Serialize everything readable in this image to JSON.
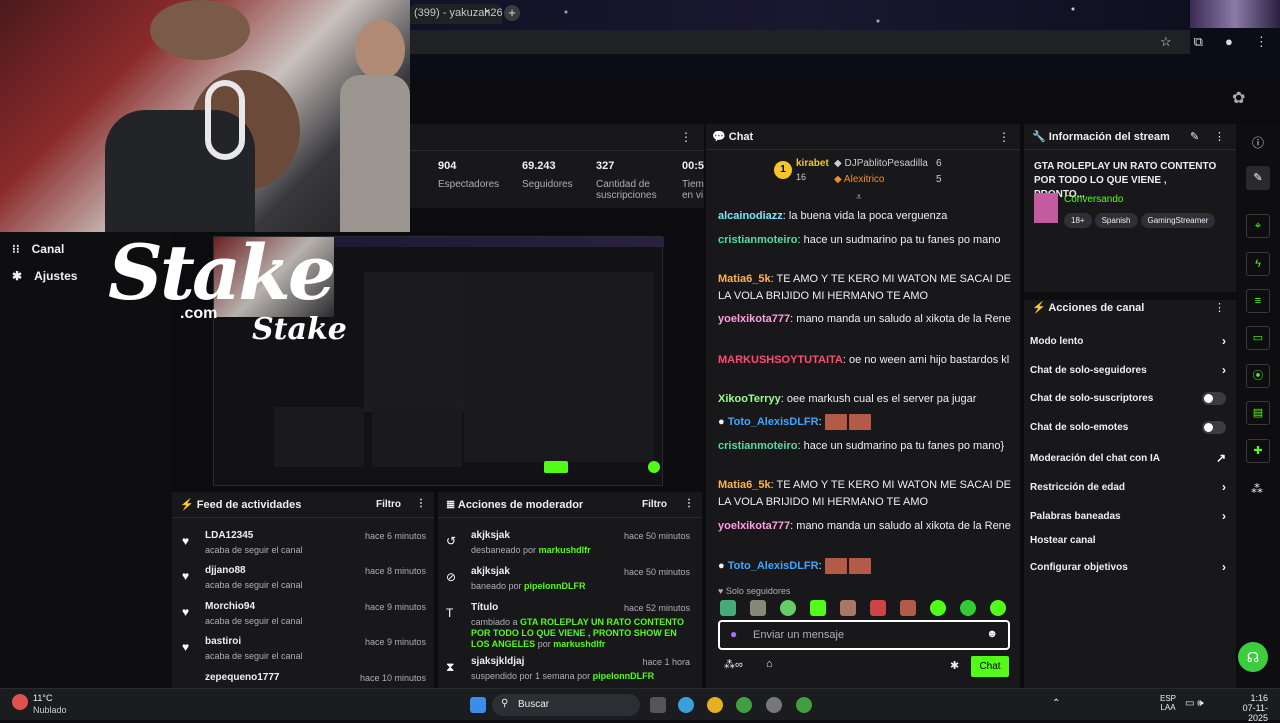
{
  "browser": {
    "tab_title": "(399) - yakuzah26",
    "tab_close": "×",
    "new_tab": "+"
  },
  "left_nav": {
    "items": [
      {
        "label": "Canal",
        "icon": "grid-icon"
      },
      {
        "label": "Ajustes",
        "icon": "gear-icon"
      }
    ]
  },
  "overlay": {
    "brand": "Stake",
    "brand_sub": ".com"
  },
  "stats": [
    {
      "value": "904",
      "label": "Espectadores"
    },
    {
      "value": "69.243",
      "label": "Seguidores"
    },
    {
      "value": "327",
      "label": "Cantidad de suscripciones"
    },
    {
      "value": "00:5",
      "label": "Tiem en vi"
    }
  ],
  "feed": {
    "title": "Feed de actividades",
    "filter": "Filtro",
    "items": [
      {
        "name": "LDA12345",
        "sub": "acaba de seguir el canal",
        "time": "hace 6 minutos"
      },
      {
        "name": "djjano88",
        "sub": "acaba de seguir el canal",
        "time": "hace 8 minutos"
      },
      {
        "name": "Morchio94",
        "sub": "acaba de seguir el canal",
        "time": "hace 9 minutos"
      },
      {
        "name": "bastiroi",
        "sub": "acaba de seguir el canal",
        "time": "hace 9 minutos"
      },
      {
        "name": "zepequeno1777",
        "sub": "",
        "time": "hace 10 minutos"
      }
    ]
  },
  "mod": {
    "title": "Acciones de moderador",
    "filter": "Filtro",
    "items": [
      {
        "name": "akjksjak",
        "pre": "desbaneado por ",
        "by": "markushdlfr",
        "post": "",
        "time": "hace 50 minutos",
        "icon": "unban-icon"
      },
      {
        "name": "akjksjak",
        "pre": "baneado por ",
        "by": "pipelonnDLFR",
        "post": "",
        "time": "hace 50 minutos",
        "icon": "ban-icon"
      },
      {
        "name": "Título",
        "pre": "cambiado a ",
        "by": "GTA ROLEPLAY UN RATO CONTENTO POR TODO LO QUE VIENE , PRONTO SHOW EN LOS ANGELES",
        "post": " por ",
        "by2": "markushdlfr",
        "time": "hace 52 minutos",
        "icon": "title-icon"
      },
      {
        "name": "sjaksjkldjaj",
        "pre": "suspendido por 1 semana por ",
        "by": "pipelonnDLFR",
        "post": "",
        "time": "hace 1 hora",
        "icon": "timeout-icon"
      }
    ]
  },
  "chat": {
    "title": "Chat",
    "leaderboard": {
      "rank1": {
        "name": "kirabet",
        "count": "16"
      },
      "rank2": {
        "name": "DJPablitoPesadilla",
        "count": "6"
      },
      "rank3": {
        "name": "Alexitrico",
        "count": "5"
      }
    },
    "messages": [
      {
        "user": "alcainodiazz",
        "color": "#7ee3ff",
        "text": "la buena vida la poca verguenza"
      },
      {
        "user": "cristianmoteiro",
        "color": "#57d9a3",
        "text": "hace un sudmarino pa tu fanes po mano"
      },
      {
        "user": "Matia6_5k",
        "color": "#ffb347",
        "text": "TE AMO Y TE KERO MI WATON ME SACAI DE LA VOLA BRIJIDO MI HERMANO TE AMO"
      },
      {
        "user": "yoelxikota777",
        "color": "#ff9ee0",
        "text": "mano manda un saludo al xikota de la Rene"
      },
      {
        "user": "MARKUSHSOYTUTAITA",
        "color": "#ff4d6d",
        "text": "oe no ween ami hijo bastardos kl"
      },
      {
        "user": "XikooTerryy",
        "color": "#9aff8c",
        "text": "oee markush cual es el server pa jugar"
      },
      {
        "user": "Toto_AlexisDLFR",
        "color": "#3ea6ff",
        "text": ""
      },
      {
        "user": "cristianmoteiro",
        "color": "#57d9a3",
        "text": "hace un sudmarino pa tu fanes po mano}"
      },
      {
        "user": "Matia6_5k",
        "color": "#ffb347",
        "text": "TE AMO Y TE KERO MI WATON ME SACAI DE LA VOLA BRIJIDO MI HERMANO TE AMO"
      },
      {
        "user": "yoelxikota777",
        "color": "#ff9ee0",
        "text": "mano manda un saludo al xikota de la Rene"
      },
      {
        "user": "Toto_AlexisDLFR",
        "color": "#3ea6ff",
        "text": ""
      }
    ],
    "mode": "Solo seguidores",
    "placeholder": "Enviar un mensaje",
    "send": "Chat"
  },
  "stream_info": {
    "title": "Información del stream",
    "stream_title": "GTA ROLEPLAY UN RATO CONTENTO POR TODO LO QUE VIENE , PRONTO...",
    "category": "Conversando",
    "tags": [
      "18+",
      "Spanish",
      "GamingStreamer"
    ]
  },
  "channel_actions": {
    "title": "Acciones de canal",
    "items": [
      "Modo lento",
      "Chat de solo-seguidores",
      "Chat de solo-suscriptores",
      "Chat de solo-emotes",
      "Moderación del chat con IA",
      "Restricción de edad",
      "Palabras baneadas",
      "Hostear canal",
      "Configurar objetivos"
    ]
  },
  "taskbar": {
    "temp": "11°C",
    "weather": "Nublado",
    "search": "Buscar",
    "lang1": "ESP",
    "lang2": "LAA",
    "time": "1:16",
    "date": "07-11-2025"
  },
  "colors": {
    "accent": "#53fc18",
    "panel": "#18181b",
    "bg": "#0e0e10"
  }
}
